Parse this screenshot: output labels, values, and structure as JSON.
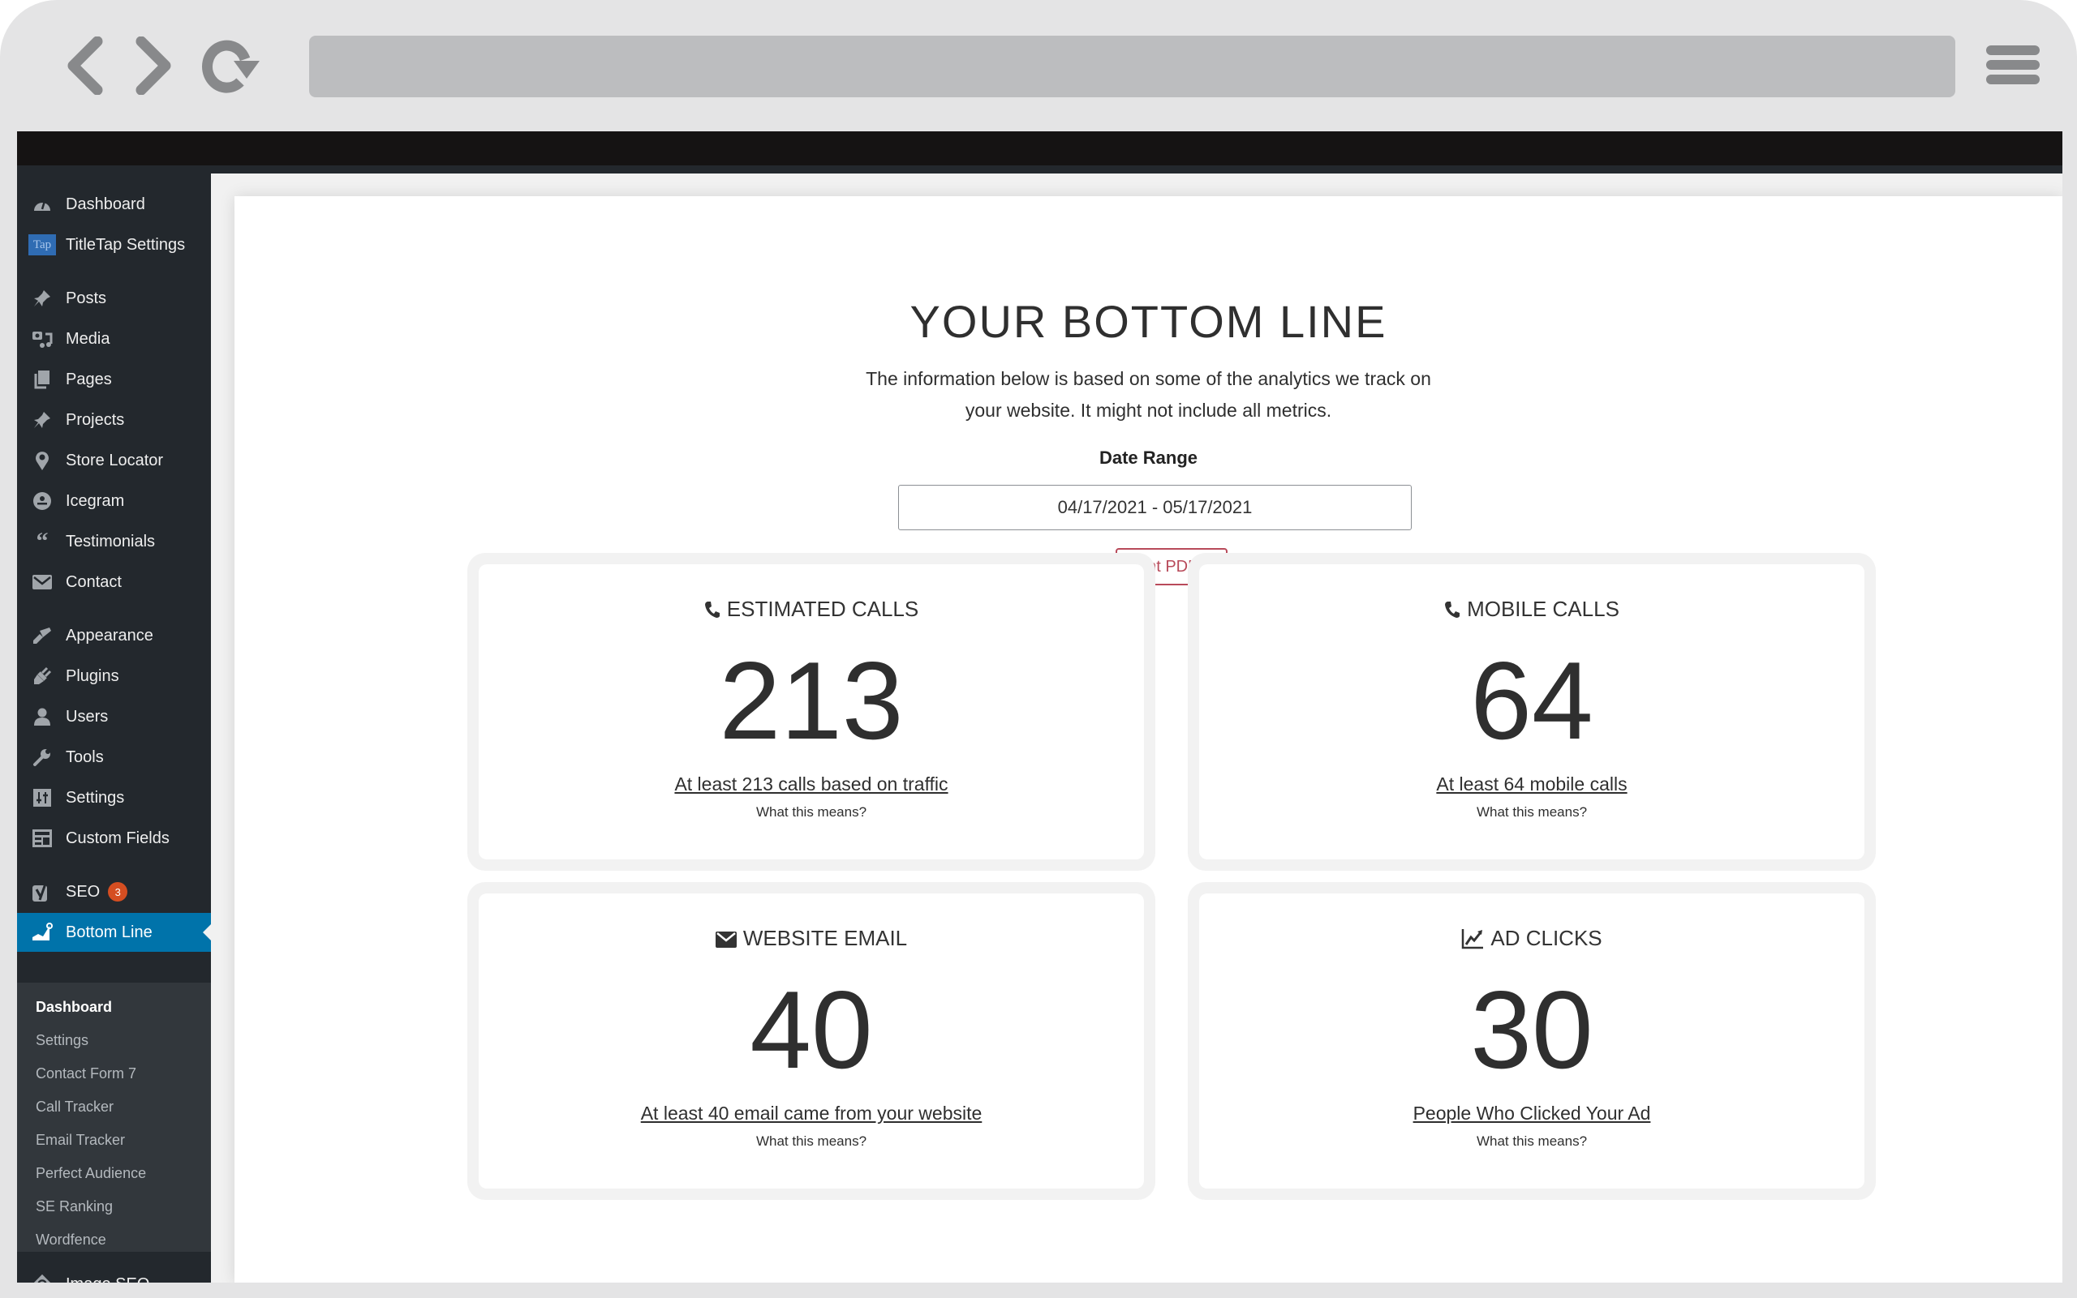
{
  "browser": {
    "back_icon": "chevron-left-icon",
    "forward_icon": "chevron-right-icon",
    "reload_icon": "reload-icon",
    "menu_icon": "hamburger-icon"
  },
  "sidebar": {
    "items": [
      {
        "label": "Dashboard",
        "icon": "dashboard-icon"
      },
      {
        "label": "TitleTap Settings",
        "icon": "titletap-icon",
        "icon_text": "Tap"
      },
      {
        "label": "Posts",
        "icon": "pushpin-icon"
      },
      {
        "label": "Media",
        "icon": "media-icon"
      },
      {
        "label": "Pages",
        "icon": "pages-icon"
      },
      {
        "label": "Projects",
        "icon": "pushpin-icon"
      },
      {
        "label": "Store Locator",
        "icon": "map-pin-icon"
      },
      {
        "label": "Icegram",
        "icon": "icegram-icon"
      },
      {
        "label": "Testimonials",
        "icon": "quote-icon"
      },
      {
        "label": "Contact",
        "icon": "envelope-icon"
      },
      {
        "label": "Appearance",
        "icon": "paintbrush-icon"
      },
      {
        "label": "Plugins",
        "icon": "plug-icon"
      },
      {
        "label": "Users",
        "icon": "user-icon"
      },
      {
        "label": "Tools",
        "icon": "wrench-icon"
      },
      {
        "label": "Settings",
        "icon": "sliders-icon"
      },
      {
        "label": "Custom Fields",
        "icon": "table-icon"
      },
      {
        "label": "SEO",
        "icon": "yoast-icon",
        "badge": "3"
      },
      {
        "label": "Bottom Line",
        "icon": "chart-line-icon",
        "active": true
      },
      {
        "label": "Image SEO",
        "icon": "image-seo-icon"
      }
    ],
    "submenu": [
      {
        "label": "Dashboard",
        "current": true
      },
      {
        "label": "Settings"
      },
      {
        "label": "Contact Form 7"
      },
      {
        "label": "Call Tracker"
      },
      {
        "label": "Email Tracker"
      },
      {
        "label": "Perfect Audience"
      },
      {
        "label": "SE Ranking"
      },
      {
        "label": "Wordfence"
      }
    ]
  },
  "main": {
    "title": "YOUR BOTTOM LINE",
    "intro_line1": "The information below is based on some of the analytics we track on",
    "intro_line2": "your website. It might not include all metrics.",
    "date_range_label": "Date Range",
    "date_range_value": "04/17/2021 - 05/17/2021",
    "print_button": "Print PDF",
    "cards": [
      {
        "icon": "phone-icon",
        "title": "ESTIMATED CALLS",
        "value": "213",
        "link": "At least 213 calls based on traffic",
        "help": "What this means?"
      },
      {
        "icon": "phone-icon",
        "title": "MOBILE CALLS",
        "value": "64",
        "link": "At least 64 mobile calls",
        "help": "What this means?"
      },
      {
        "icon": "envelope-icon",
        "title": "WEBSITE EMAIL",
        "value": "40",
        "link": "At least 40 email came from your website",
        "help": "What this means?"
      },
      {
        "icon": "line-chart-icon",
        "title": "AD CLICKS",
        "value": "30",
        "link": "People Who Clicked Your Ad",
        "help": "What this means?"
      }
    ]
  },
  "colors": {
    "wp_sidebar": "#23282d",
    "wp_submenu": "#32373c",
    "wp_active": "#0073aa",
    "badge": "#d54e21",
    "print_accent": "#b84a5a",
    "text_dark": "#2f2f2f"
  }
}
